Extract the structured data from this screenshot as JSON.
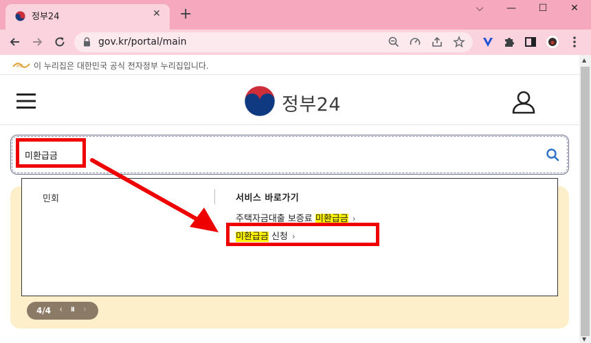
{
  "browser": {
    "tab_title": "정부24",
    "tab_close": "✕",
    "new_tab": "+",
    "url": "gov.kr/portal/main",
    "window": {
      "minimize": "⌵",
      "restore": "—",
      "maximize": "☐",
      "close": "✕"
    }
  },
  "notice": {
    "text": "이 누리집은 대한민국 공식 전자정부 누리집입니다."
  },
  "header": {
    "title": "정부24"
  },
  "search": {
    "value": "미환급금"
  },
  "dropdown": {
    "category": "민회",
    "service_header": "서비스 바로가기",
    "items": [
      {
        "prefix": "주택자금대출 보증료 ",
        "highlight": "미환급금",
        "suffix": ""
      },
      {
        "prefix": "",
        "highlight": "미환급금",
        "suffix": " 신청"
      }
    ],
    "chevron": "›"
  },
  "pager": {
    "count": "4/4",
    "prev": "‹",
    "pause": "II",
    "next": "›"
  },
  "colors": {
    "tab_bar": "#f6a9be",
    "banner": "#fdefc9",
    "highlight": "#fff200",
    "annotation": "#ee0000",
    "search_icon": "#2d72c9"
  }
}
